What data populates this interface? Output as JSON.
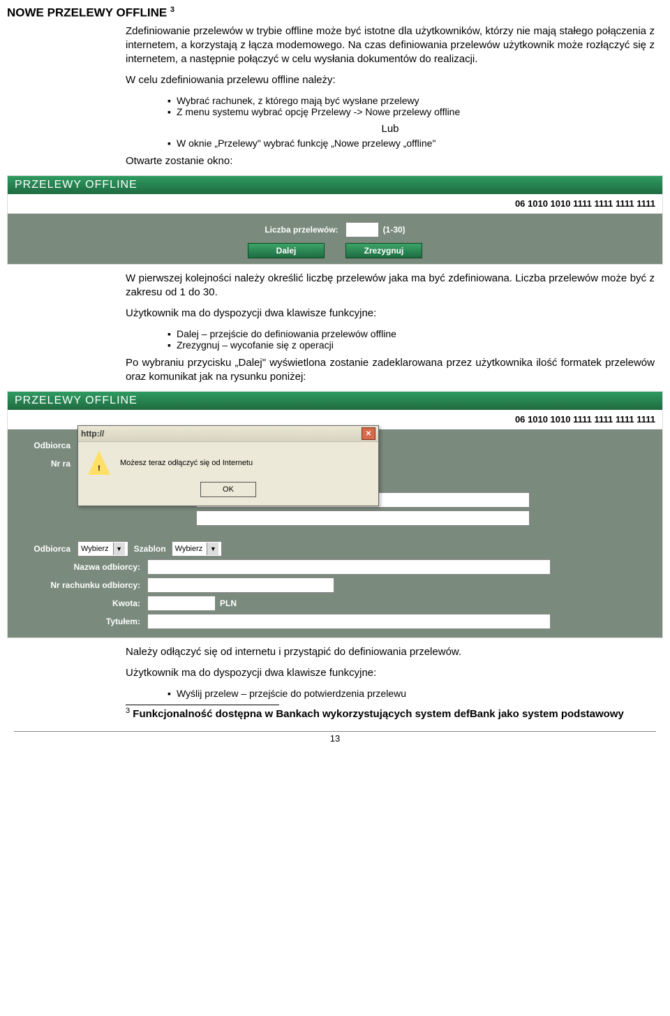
{
  "title": "NOWE PRZELEWY OFFLINE",
  "title_ref": "3",
  "intro_p1": "Zdefiniowanie przelewów w trybie offline może być istotne dla użytkowników, którzy nie mają stałego połączenia z internetem, a korzystają z łącza modemowego. Na czas definiowania przelewów użytkownik może rozłączyć się z internetem, a następnie połączyć w celu wysłania dokumentów do realizacji.",
  "intro_p2": "W celu zdefiniowania przelewu offline należy:",
  "bullets_a": [
    "Wybrać rachunek, z którego mają być wysłane przelewy",
    "Z menu systemu wybrać opcję Przelewy -> Nowe przelewy offline"
  ],
  "lub": "Lub",
  "bullets_b": [
    "W oknie „Przelewy\" wybrać funkcję „Nowe przelewy „offline\""
  ],
  "opened": "Otwarte zostanie okno:",
  "panel1": {
    "title": "PRZELEWY OFFLINE",
    "account": "06 1010 1010 1111 1111 1111 1111",
    "label_count": "Liczba przelewów:",
    "range": "(1-30)",
    "btn_next": "Dalej",
    "btn_cancel": "Zrezygnuj"
  },
  "p2": "W pierwszej kolejności należy określić liczbę przelewów jaka ma być zdefiniowana. Liczba przelewów może być z zakresu od 1 do 30.",
  "p3_intro": "Użytkownik ma do dyspozycji dwa klawisze funkcyjne:",
  "bullets_c": [
    "Dalej – przejście do definiowania przelewów offline",
    "Zrezygnuj – wycofanie się z operacji"
  ],
  "p4": "Po wybraniu przycisku „Dalej\" wyświetlona zostanie zadeklarowana przez użytkownika ilość formatek przelewów oraz komunikat jak na rysunku poniżej:",
  "panel2": {
    "title": "PRZELEWY OFFLINE",
    "account": "06 1010 1010 1111 1111 1111 1111",
    "label_odbiorca": "Odbiorca",
    "select_wybierz": "Wybierz",
    "label_szablon": "Szablon",
    "label_nr_ra": "Nr ra",
    "label_nazwa": "Nazwa odbiorcy:",
    "label_nr_rach": "Nr rachunku odbiorcy:",
    "label_kwota": "Kwota:",
    "pln": "PLN",
    "label_tytul": "Tytułem:"
  },
  "dialog": {
    "title": "http://",
    "msg": "Możesz teraz odłączyć się od Internetu",
    "ok": "OK"
  },
  "p5": "Należy odłączyć się od internetu i przystąpić do definiowania przelewów.",
  "p6_intro": "Użytkownik ma do dyspozycji dwa klawisze funkcyjne:",
  "bullets_d": [
    "Wyślij przelew – przejście do potwierdzenia przelewu"
  ],
  "footnote_ref": "3",
  "footnote": "Funkcjonalność dostępna w Bankach wykorzystujących system defBank jako system podstawowy",
  "page_num": "13"
}
